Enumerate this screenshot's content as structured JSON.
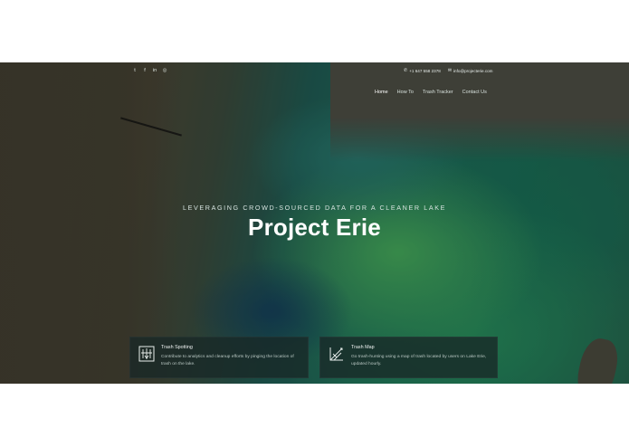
{
  "social": [
    {
      "icon": "twitter-icon",
      "glyph": "t"
    },
    {
      "icon": "facebook-icon",
      "glyph": "f"
    },
    {
      "icon": "linkedin-icon",
      "glyph": "in"
    },
    {
      "icon": "instagram-icon",
      "glyph": "◎"
    }
  ],
  "contact": {
    "phone": "+1 647 558 2378",
    "email": "info@projecterie.com"
  },
  "nav": {
    "items": [
      "Home",
      "How To",
      "Trash Tracker",
      "Contact Us"
    ],
    "active": "Home"
  },
  "hero": {
    "tagline": "LEVERAGING CROWD-SOURCED DATA FOR A CLEANER LAKE",
    "title": "Project Erie"
  },
  "cards": [
    {
      "title": "Trash Spotting",
      "description": "Contribute to analytics and cleanup efforts by pinging the location of trash on the lake."
    },
    {
      "title": "Trash Map",
      "description": "Go trash-hunting using a map of trash located by users on Lake Erie, updated hourly."
    }
  ]
}
